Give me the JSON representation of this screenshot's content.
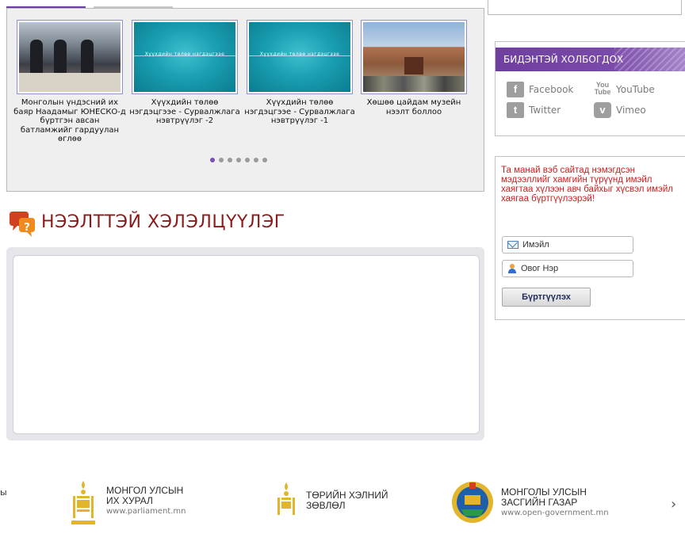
{
  "gallery": {
    "items": [
      {
        "caption": "Монголын үндэсний их баяр Наадамыг ЮНЕСКО-д бүртгэн авсан батламжийг гардуулан өглөө"
      },
      {
        "caption": "Хүүхдийн төлөө нэгдэцгээе - Сурвалжлага нэвтрүүлэг -2",
        "image_text": "Хүүхдийн төлөө нэгдэцгээе"
      },
      {
        "caption": "Хүүхдийн төлөө нэгдэцгээе - Сурвалжлага нэвтрүүлэг -1",
        "image_text": "Хүүхдийн төлөө нэгдэцгээе"
      },
      {
        "caption": "Хөшөө цайдам музейн нээлт боллоо"
      }
    ],
    "dots_count": 7,
    "active_dot": 0
  },
  "discussion": {
    "title": "НЭЭЛТТЭЙ ХЭЛЭЛЦҮҮЛЭГ"
  },
  "contact": {
    "title": "БИДЭНТЭЙ ХОЛБОГДОХ",
    "links": [
      {
        "label": "Facebook",
        "icon": "facebook-icon"
      },
      {
        "label": "YouTube",
        "icon": "youtube-icon",
        "icon_text": "You Tube"
      },
      {
        "label": "Twitter",
        "icon": "twitter-icon"
      },
      {
        "label": "Vimeo",
        "icon": "vimeo-icon"
      }
    ]
  },
  "subscribe": {
    "message": "Та манай вэб сайтад нэмэгдсэн мэдээллийг хамгийн түрүүнд имэйл хаягтаа хүлээн авч байхыг хүсвэл имэйл хаягаа бүртгүүлээрэй!",
    "email_placeholder": "Имэйл",
    "name_placeholder": "Овог Нэр",
    "button_label": "Бүртгүүлэх"
  },
  "footer": {
    "fragment_text": "ы",
    "logos": [
      {
        "line1": "МОНГОЛ УЛСЫН",
        "line2": "ИХ ХУРАЛ",
        "url": "www.parliament.mn"
      },
      {
        "line1": "ТӨРИЙН ХЭЛНИЙ",
        "line2": "ЗӨВЛӨЛ",
        "url": ""
      },
      {
        "line1": "МОНГОЛЫ УЛСЫН",
        "line2": "ЗАСГИЙН ГАЗАР",
        "url": "www.open-government.mn"
      }
    ],
    "next_glyph": "›"
  },
  "colors": {
    "accent_purple": "#6f3f9f",
    "heading_red": "#8b1a1a",
    "subscribe_red": "#cc1f1f",
    "emblem_gold": "#e2b52d"
  }
}
